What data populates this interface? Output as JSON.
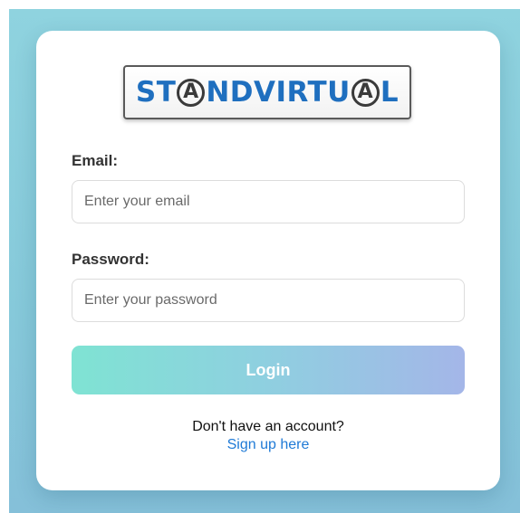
{
  "brand": {
    "logo_parts": [
      "ST",
      "A",
      "NDVIRTU",
      "A",
      "L"
    ],
    "logo_color": "#1f6fbf",
    "logo_ring_color": "#3a3a3a"
  },
  "form": {
    "email_label": "Email:",
    "email_placeholder": "Enter your email",
    "email_value": "",
    "password_label": "Password:",
    "password_placeholder": "Enter your password",
    "password_value": "",
    "login_label": "Login"
  },
  "signup": {
    "prompt": "Don't have an account?",
    "link_label": "Sign up here"
  },
  "colors": {
    "background": "#8fd3df",
    "button_gradient_start": "#7fe3d3",
    "button_gradient_end": "#a4b6e8",
    "link": "#1f7ad6"
  }
}
